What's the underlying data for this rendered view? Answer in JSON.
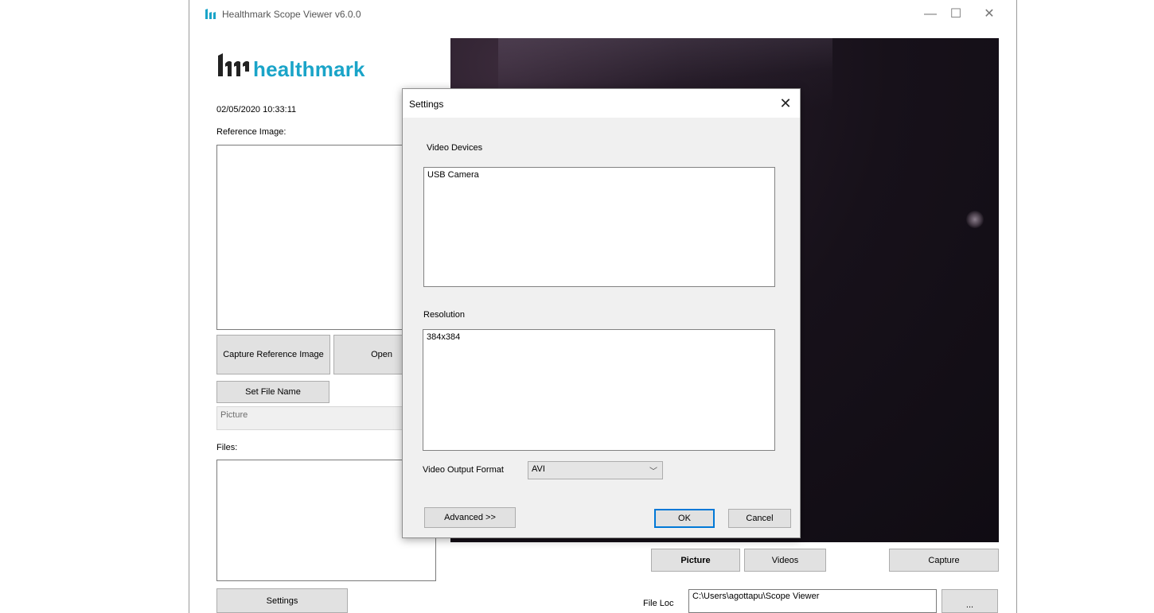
{
  "window": {
    "title": "Healthmark Scope Viewer v6.0.0",
    "controls": {
      "minimize": "—",
      "maximize": "☐",
      "close": "✕"
    }
  },
  "brand": {
    "name": "healthmark",
    "color": "#1aa4c8"
  },
  "left": {
    "datetime": "02/05/2020 10:33:11",
    "reference_label": "Reference Image:",
    "capture_ref_button": "Capture Reference Image",
    "open_button": "Open",
    "set_file_name_button": "Set File Name",
    "file_name_placeholder": "Picture",
    "files_label": "Files:",
    "settings_button": "Settings"
  },
  "bottom": {
    "picture_button": "Picture",
    "videos_button": "Videos",
    "capture_button": "Capture",
    "file_loc_label": "File Loc",
    "file_loc_value": "C:\\Users\\agottapu\\Scope Viewer",
    "browse_button": "..."
  },
  "dialog": {
    "title": "Settings",
    "close": "✕",
    "video_devices_label": "Video Devices",
    "video_devices": [
      "USB Camera"
    ],
    "resolution_label": "Resolution",
    "resolutions": [
      "384x384"
    ],
    "output_format_label": "Video Output Format",
    "output_format_value": "AVI",
    "advanced_button": "Advanced >>",
    "ok_button": "OK",
    "cancel_button": "Cancel"
  }
}
